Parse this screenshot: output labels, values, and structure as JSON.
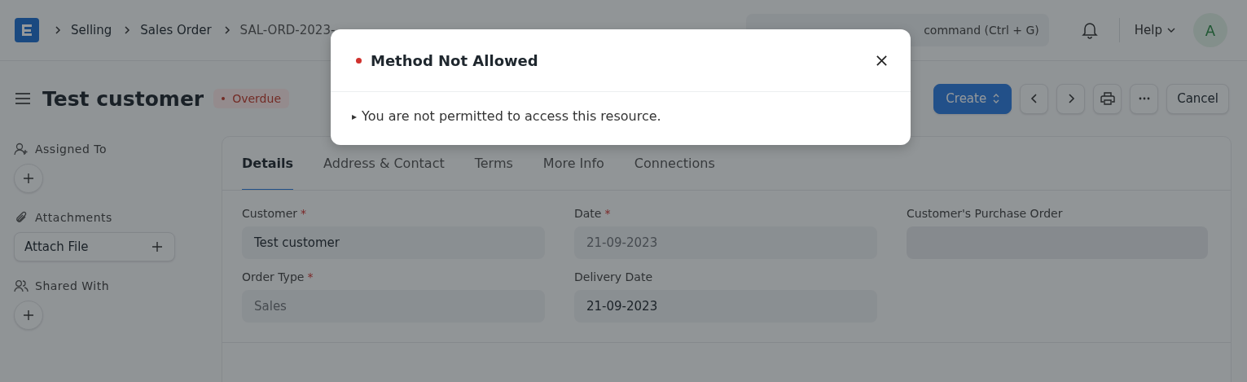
{
  "navbar": {
    "breadcrumbs": [
      "Selling",
      "Sales Order",
      "SAL-ORD-2023-"
    ],
    "search": {
      "placeholder": "command (Ctrl + G)"
    },
    "help": "Help",
    "avatar": "A"
  },
  "header": {
    "title": "Test customer",
    "status": "Overdue",
    "create": "Create",
    "cancel": "Cancel"
  },
  "sidebar": [
    {
      "kind": "add",
      "label": "Assigned To"
    },
    {
      "kind": "attach",
      "label": "Attachments",
      "button": "Attach File"
    },
    {
      "kind": "add",
      "label": "Shared With"
    }
  ],
  "tabs": [
    {
      "label": "Details",
      "selected": true
    },
    {
      "label": "Address & Contact",
      "selected": false
    },
    {
      "label": "Terms",
      "selected": false
    },
    {
      "label": "More Info",
      "selected": false
    },
    {
      "label": "Connections",
      "selected": false
    }
  ],
  "fields": [
    {
      "label": "Customer",
      "required_mark": "*",
      "value": "Test customer",
      "disabled": false
    },
    {
      "label": "Date",
      "required_mark": "*",
      "value": "21-09-2023",
      "disabled": true
    },
    {
      "label": "Customer's Purchase Order"
    },
    {
      "label": "Order Type",
      "required_mark": "*",
      "value": "Sales",
      "disabled": true
    },
    {
      "label": "Delivery Date",
      "value": "21-09-2023",
      "disabled": false
    }
  ],
  "modal": {
    "title": "Method Not Allowed",
    "toggle": "▸",
    "message": "You are not permitted to access this resource."
  }
}
